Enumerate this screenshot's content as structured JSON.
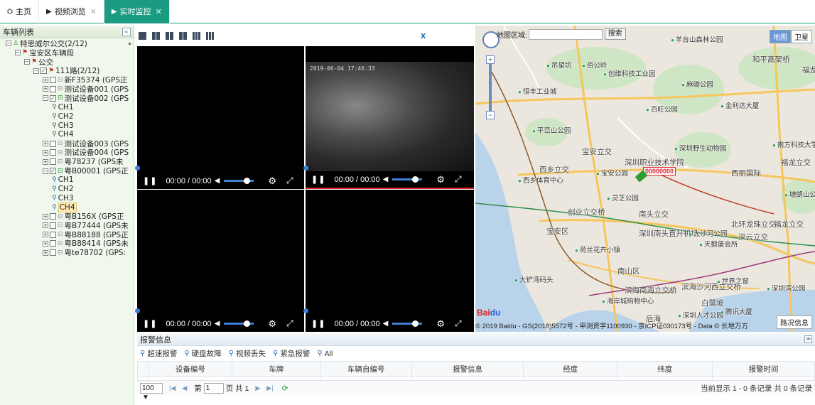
{
  "tabs": [
    {
      "label": "主页",
      "icon": "dashboard-icon",
      "closable": false,
      "active": false
    },
    {
      "label": "视频浏览",
      "icon": "play-icon",
      "closable": true,
      "active": false
    },
    {
      "label": "实时监控",
      "icon": "play-icon",
      "closable": true,
      "active": true
    }
  ],
  "sidebar": {
    "title": "车辆列表",
    "tree": [
      {
        "level": 0,
        "toggle": "−",
        "check": "",
        "icon": "org",
        "label": "特思威尔公交(2/12)"
      },
      {
        "level": 1,
        "toggle": "−",
        "check": "",
        "icon": "flag",
        "label": "宝安区车辆段"
      },
      {
        "level": 2,
        "toggle": "−",
        "check": "",
        "icon": "flag",
        "label": "公交"
      },
      {
        "level": 3,
        "toggle": "−",
        "check": "✓",
        "icon": "flag",
        "label": "111路(2/12)"
      },
      {
        "level": 4,
        "toggle": "+",
        "check": " ",
        "icon": "bus",
        "label": "新F35374 (GPS正"
      },
      {
        "level": 4,
        "toggle": "+",
        "check": " ",
        "icon": "bus",
        "label": "测试设备001 (GPS"
      },
      {
        "level": 4,
        "toggle": "−",
        "check": "✓",
        "icon": "bus-online",
        "label": "测试设备002 (GPS"
      },
      {
        "level": 5,
        "toggle": "",
        "check": "",
        "icon": "cam",
        "label": "CH1"
      },
      {
        "level": 5,
        "toggle": "",
        "check": "",
        "icon": "cam",
        "label": "CH2"
      },
      {
        "level": 5,
        "toggle": "",
        "check": "",
        "icon": "cam",
        "label": "CH3"
      },
      {
        "level": 5,
        "toggle": "",
        "check": "",
        "icon": "cam",
        "label": "CH4"
      },
      {
        "level": 4,
        "toggle": "+",
        "check": " ",
        "icon": "bus",
        "label": "测试设备003 (GPS"
      },
      {
        "level": 4,
        "toggle": "+",
        "check": " ",
        "icon": "bus",
        "label": "测试设备004 (GPS"
      },
      {
        "level": 4,
        "toggle": "+",
        "check": " ",
        "icon": "bus",
        "label": "粤78237 (GPS未"
      },
      {
        "level": 4,
        "toggle": "−",
        "check": "✓",
        "icon": "bus-online",
        "label": "粤B00001 (GPS正"
      },
      {
        "level": 5,
        "toggle": "",
        "check": "",
        "icon": "cam-on",
        "label": "CH1"
      },
      {
        "level": 5,
        "toggle": "",
        "check": "",
        "icon": "cam-on",
        "label": "CH2"
      },
      {
        "level": 5,
        "toggle": "",
        "check": "",
        "icon": "cam-on",
        "label": "CH3"
      },
      {
        "level": 5,
        "toggle": "",
        "check": "",
        "icon": "cam-on",
        "label": "CH4",
        "selected": true
      },
      {
        "level": 4,
        "toggle": "+",
        "check": " ",
        "icon": "bus",
        "label": "粤B156X (GPS正"
      },
      {
        "level": 4,
        "toggle": "+",
        "check": " ",
        "icon": "bus",
        "label": "粤B77444 (GPS未"
      },
      {
        "level": 4,
        "toggle": "+",
        "check": " ",
        "icon": "bus",
        "label": "粤B88188 (GPS正"
      },
      {
        "level": 4,
        "toggle": "+",
        "check": " ",
        "icon": "bus",
        "label": "粤B88414 (GPS未"
      },
      {
        "level": 4,
        "toggle": "+",
        "check": " ",
        "icon": "bus",
        "label": "粤te78702 (GPS:"
      }
    ]
  },
  "video": {
    "close_label": "x",
    "layout_icons": [
      "layout-1-icon",
      "layout-4-icon",
      "layout-6-icon",
      "layout-8-icon",
      "layout-9-icon",
      "layout-16-icon"
    ],
    "panes": [
      {
        "time": "00:00 / 00:00",
        "has_feed": false
      },
      {
        "time": "00:00 / 00:00",
        "has_feed": true,
        "timestamp": "2019-06-04 17:46:33"
      },
      {
        "time": "00:00 / 00:00",
        "has_feed": false
      },
      {
        "time": "00:00 / 00:00",
        "has_feed": false
      }
    ]
  },
  "map": {
    "region_label": "地图区域:",
    "search_button": "搜索",
    "type_map": "地图",
    "type_satellite": "卫星",
    "traffic_button": "路况信息",
    "copyright": "© 2019 Baidu - GS(2018)5572号 - 甲测资字1100930 - 京ICP证030173号 - Data © 长地万方",
    "vehicle_label": "00000000",
    "labels": [
      {
        "text": "羊台山森林公园",
        "poi": true
      },
      {
        "text": "和平高架桥",
        "poi": false
      },
      {
        "text": "吊望坊",
        "poi": true
      },
      {
        "text": "佰公岭",
        "poi": true
      },
      {
        "text": "创维科技工业园",
        "poi": true
      },
      {
        "text": "麻磡公园",
        "poi": true
      },
      {
        "text": "福龙路",
        "poi": false
      },
      {
        "text": "恒丰工业城",
        "poi": true
      },
      {
        "text": "百旺公园",
        "poi": true
      },
      {
        "text": "金利达大厦",
        "poi": true
      },
      {
        "text": "平峦山公园",
        "poi": true
      },
      {
        "text": "深圳野生动物园",
        "poi": true
      },
      {
        "text": "南方科技大学",
        "poi": true
      },
      {
        "text": "宝安立交",
        "poi": false
      },
      {
        "text": "深圳职业技术学院",
        "poi": false
      },
      {
        "text": "西乡立交",
        "poi": false
      },
      {
        "text": "宝安公园",
        "poi": true
      },
      {
        "text": "西丽国际",
        "poi": false
      },
      {
        "text": "福龙立交",
        "poi": false
      },
      {
        "text": "西乡体育中心",
        "poi": true
      },
      {
        "text": "灵芝公园",
        "poi": true
      },
      {
        "text": "塘朗山公园",
        "poi": true
      },
      {
        "text": "创业立交桥",
        "poi": false
      },
      {
        "text": "南头立交",
        "poi": false
      },
      {
        "text": "宝安区",
        "poi": false
      },
      {
        "text": "深圳南头直升机场",
        "poi": false
      },
      {
        "text": "大沙河公园",
        "poi": true
      },
      {
        "text": "北环龙珠立交",
        "poi": false
      },
      {
        "text": "深云立交",
        "poi": false
      },
      {
        "text": "福龙立交",
        "poi": false
      },
      {
        "text": "天鹅堡会所",
        "poi": true
      },
      {
        "text": "荷兰花卉小镇",
        "poi": true
      },
      {
        "text": "南山区",
        "poi": false
      },
      {
        "text": "大铲湾码头",
        "poi": true
      },
      {
        "text": "世界之窗",
        "poi": true
      },
      {
        "text": "滨海南海立交桥",
        "poi": false
      },
      {
        "text": "滨海沙河西立交桥",
        "poi": false
      },
      {
        "text": "深圳湾公园",
        "poi": true
      },
      {
        "text": "海岸城购物中心",
        "poi": true
      },
      {
        "text": "白鹭坡",
        "poi": false
      },
      {
        "text": "深圳人才公园",
        "poi": true
      },
      {
        "text": "后海",
        "poi": false
      },
      {
        "text": "腾讯大厦",
        "poi": true
      }
    ]
  },
  "alarm": {
    "title": "报警信息",
    "filters": [
      "超速报警",
      "硬盘故障",
      "视频丢失",
      "紧急报警",
      "All"
    ],
    "columns": [
      "",
      "设备编号",
      "车牌",
      "车辆自编号",
      "报警信息",
      "经度",
      "纬度",
      "报警时间"
    ],
    "pager": {
      "page_size": "100 ▼",
      "page_prefix": "第",
      "page_value": "1",
      "page_suffix": "页 共 1",
      "summary": "当前显示 1 - 0 条记录 共 0 条记录"
    }
  }
}
